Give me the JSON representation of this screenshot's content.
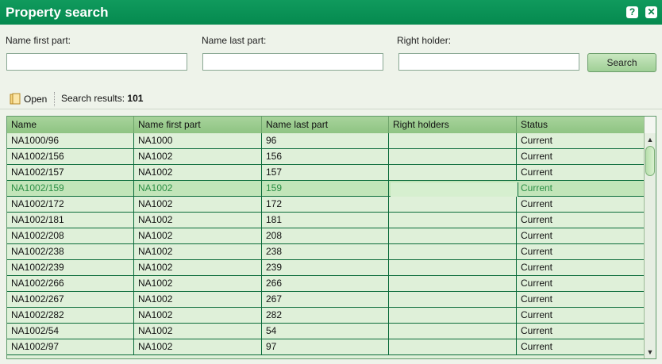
{
  "window": {
    "title": "Property search",
    "help_label": "?",
    "close_label": "✕"
  },
  "form": {
    "name_first_label": "Name first part:",
    "name_last_label": "Name last part:",
    "right_holder_label": "Right holder:",
    "name_first_value": "",
    "name_last_value": "",
    "right_holder_value": "",
    "search_label": "Search"
  },
  "toolbar": {
    "open_label": "Open",
    "results_label": "Search results:",
    "results_count": "101"
  },
  "table": {
    "headers": [
      "Name",
      "Name first part",
      "Name last part",
      "Right holders",
      "Status"
    ],
    "rows": [
      [
        "NA1000/96",
        "NA1000",
        "96",
        "",
        "Current"
      ],
      [
        "NA1002/156",
        "NA1002",
        "156",
        "",
        "Current"
      ],
      [
        "NA1002/157",
        "NA1002",
        "157",
        "",
        "Current"
      ],
      [
        "NA1002/159",
        "NA1002",
        "159",
        "",
        "Current"
      ],
      [
        "NA1002/172",
        "NA1002",
        "172",
        "",
        "Current"
      ],
      [
        "NA1002/181",
        "NA1002",
        "181",
        "",
        "Current"
      ],
      [
        "NA1002/208",
        "NA1002",
        "208",
        "",
        "Current"
      ],
      [
        "NA1002/238",
        "NA1002",
        "238",
        "",
        "Current"
      ],
      [
        "NA1002/239",
        "NA1002",
        "239",
        "",
        "Current"
      ],
      [
        "NA1002/266",
        "NA1002",
        "266",
        "",
        "Current"
      ],
      [
        "NA1002/267",
        "NA1002",
        "267",
        "",
        "Current"
      ],
      [
        "NA1002/282",
        "NA1002",
        "282",
        "",
        "Current"
      ],
      [
        "NA1002/54",
        "NA1002",
        "54",
        "",
        "Current"
      ],
      [
        "NA1002/97",
        "NA1002",
        "97",
        "",
        "Current"
      ]
    ],
    "selected_row": 3
  },
  "icons": {
    "open": "folder-open-icon",
    "scroll_up": "scroll-up-arrow-icon",
    "scroll_down": "scroll-down-arrow-icon"
  },
  "colors": {
    "title_bar": "#058a4f",
    "grid_bg": "#dff0d9",
    "header_bg": "#8fc483",
    "selected_row": "#c2e5b9",
    "selected_text": "#2b8f45"
  }
}
